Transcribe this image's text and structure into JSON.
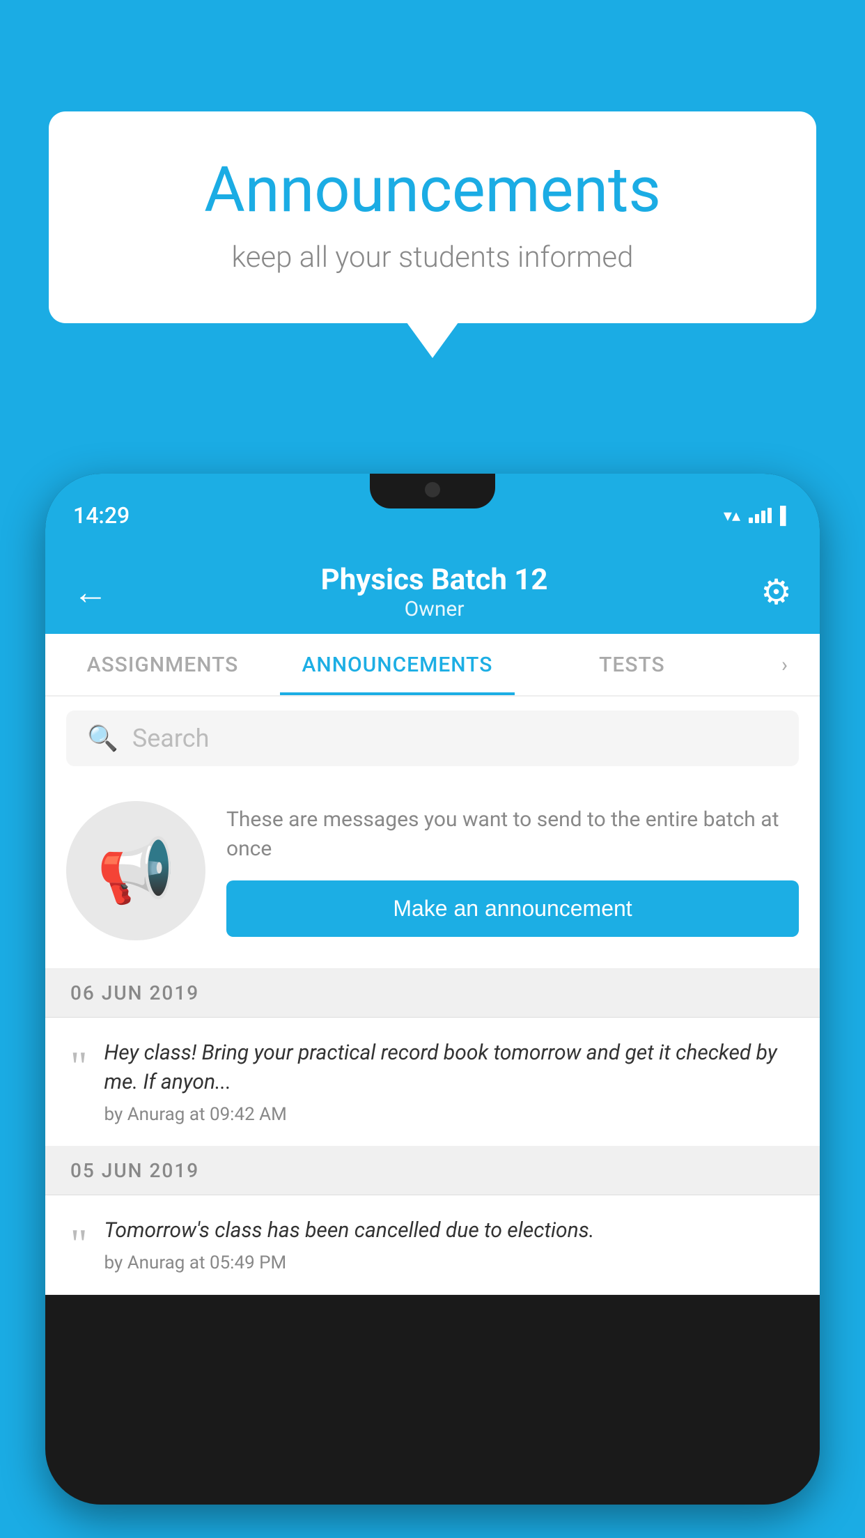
{
  "background_color": "#1BACE4",
  "speech_bubble": {
    "title": "Announcements",
    "subtitle": "keep all your students informed"
  },
  "phone": {
    "status_bar": {
      "time": "14:29"
    },
    "app_header": {
      "title": "Physics Batch 12",
      "subtitle": "Owner",
      "back_label": "←",
      "gear_label": "⚙"
    },
    "tabs": [
      {
        "label": "ASSIGNMENTS",
        "active": false
      },
      {
        "label": "ANNOUNCEMENTS",
        "active": true
      },
      {
        "label": "TESTS",
        "active": false
      }
    ],
    "search": {
      "placeholder": "Search"
    },
    "promo_block": {
      "description": "These are messages you want to send to the entire batch at once",
      "button_label": "Make an announcement"
    },
    "announcements": [
      {
        "date": "06  JUN  2019",
        "message": "Hey class! Bring your practical record book tomorrow and get it checked by me. If anyon...",
        "meta": "by Anurag at 09:42 AM"
      },
      {
        "date": "05  JUN  2019",
        "message": "Tomorrow's class has been cancelled due to elections.",
        "meta": "by Anurag at 05:49 PM"
      }
    ]
  }
}
